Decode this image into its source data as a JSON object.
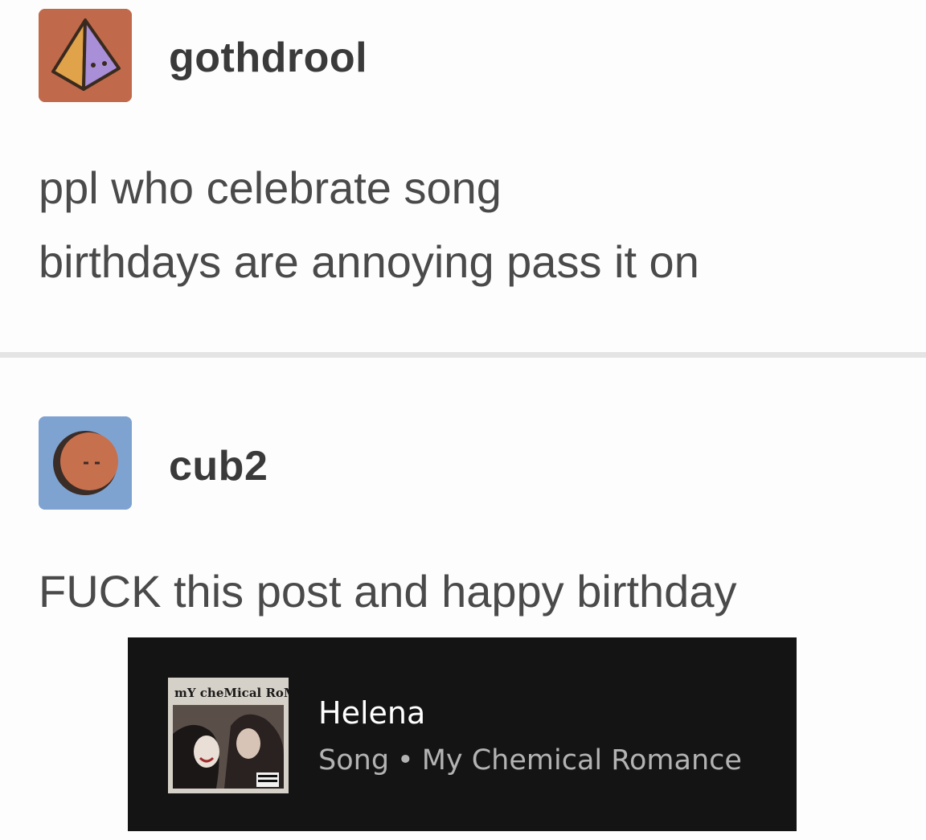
{
  "posts": [
    {
      "username": "gothdrool",
      "avatar_icon": "pyramid-icon",
      "avatar_color": "#c06a4b",
      "lines": [
        "ppl who celebrate song",
        "birthdays are annoying pass it on"
      ]
    },
    {
      "username": "cub2",
      "avatar_icon": "round-face-icon",
      "avatar_color": "#7fa3d1",
      "lines": [
        "FUCK this post and happy birthday"
      ]
    }
  ],
  "song_card": {
    "title": "Helena",
    "type_label": "Song",
    "separator": "•",
    "artist": "My Chemical Romance",
    "cover_text": "mY cheMical RoMaNcE."
  }
}
